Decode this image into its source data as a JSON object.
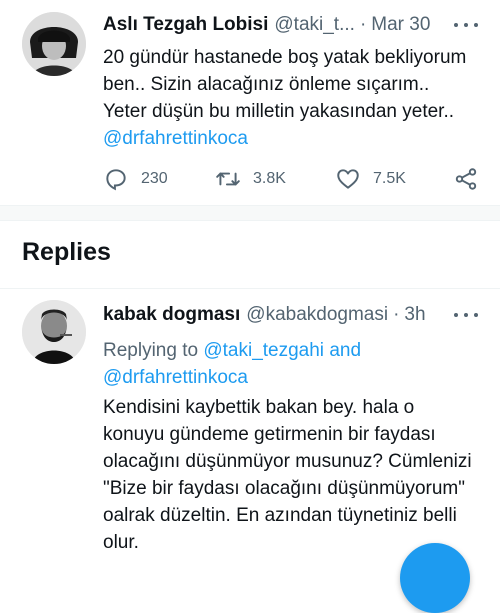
{
  "original_tweet": {
    "author_name": "Aslı Tezgah Lobisi",
    "author_handle": "@taki_t...",
    "separator": "·",
    "timestamp": "Mar 30",
    "text_lines": [
      "20 gündür hastanede boş yatak bekliyorum",
      "ben.. Sizin alacağınız önleme sıçarım..",
      "Yeter düşün bu milletin yakasından yeter.."
    ],
    "mention": "@drfahrettinkoca",
    "stats": {
      "replies": "230",
      "retweets": "3.8K",
      "likes": "7.5K"
    }
  },
  "replies_section": {
    "title": "Replies"
  },
  "reply": {
    "author_name": "kabak dogması",
    "author_handle": "@kabakdogmasi",
    "separator": "·",
    "timestamp": "3h",
    "replying_prefix": "Replying to",
    "replying_mention_1": "@taki_tezgahi",
    "replying_and": "and",
    "replying_mention_2": "@drfahrettinkoca",
    "text_lines": [
      "Kendisini kaybettik bakan bey. hala o",
      "konuyu gündeme getirmenin bir faydası",
      "olacağını düşünmüyor musunuz? Cümlenizi",
      "\"Bize bir faydası olacağını düşünmüyorum\"",
      "oalrak düzeltin. En azından tüynetiniz belli",
      "olur."
    ]
  },
  "icons": {
    "reply": "reply-icon",
    "retweet": "retweet-icon",
    "like": "heart-icon",
    "share": "share-icon",
    "more": "more-icon"
  },
  "colors": {
    "accent": "#1d9bf0",
    "text": "#0f1419",
    "muted": "#536471"
  }
}
